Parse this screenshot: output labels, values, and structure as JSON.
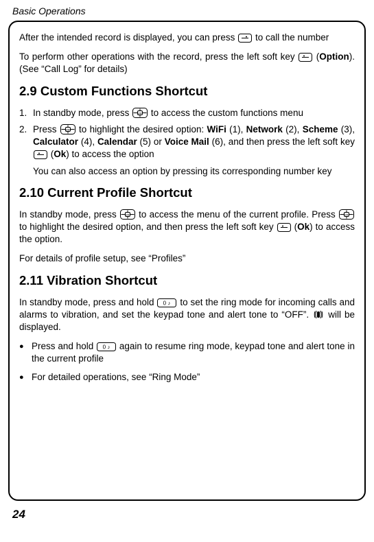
{
  "header": {
    "title": "Basic Operations"
  },
  "intro": {
    "p1a": "After the intended record is displayed, you can press ",
    "p1b": " to call the number",
    "p2a": "To perform other operations with the record, press the left soft key ",
    "p2b": " (",
    "p2c": "Option",
    "p2d": "). (See “Call Log” for details)"
  },
  "s29": {
    "heading": "2.9 Custom Functions Shortcut",
    "i1": {
      "num": "1.",
      "a": "In standby mode, press ",
      "b": " to access the custom functions menu"
    },
    "i2": {
      "num": "2.",
      "a": "Press ",
      "b": " to highlight the desired option: ",
      "wifi": "WiFi",
      "n1": " (1), ",
      "net": "Network",
      "n2": " (2), ",
      "sch": "Scheme",
      "n3": " (3), ",
      "calc": "Calculator",
      "n4": " (4), ",
      "cal": "Calendar",
      "n5": " (5) or ",
      "vm": "Voice Mail",
      "n6": " (6), and then press the left soft key ",
      "c": " (",
      "ok": "Ok",
      "d": ") to access the option"
    },
    "sub": "You can also access an option by pressing its corresponding number key"
  },
  "s210": {
    "heading": "2.10 Current Profile Shortcut",
    "p1a": "In standby mode, press ",
    "p1b": " to access the menu of the current profile. Press ",
    "p1c": " to highlight the desired option, and then press the left soft key ",
    "p1d": " (",
    "ok": "Ok",
    "p1e": ") to access the option.",
    "p2": "For details of profile setup, see “Profiles”"
  },
  "s211": {
    "heading": "2.11 Vibration Shortcut",
    "p1a": "In standby mode, press and hold ",
    "p1b": " to set the ring mode for incoming calls and alarms to vibration, and set the keypad tone and alert tone to “OFF”. ",
    "p1c": " will be displayed.",
    "b1a": "Press and hold ",
    "b1b": " again to resume ring mode, keypad tone and alert tone in the current profile",
    "b2": "For detailed operations, see “Ring Mode”"
  },
  "page_number": "24"
}
